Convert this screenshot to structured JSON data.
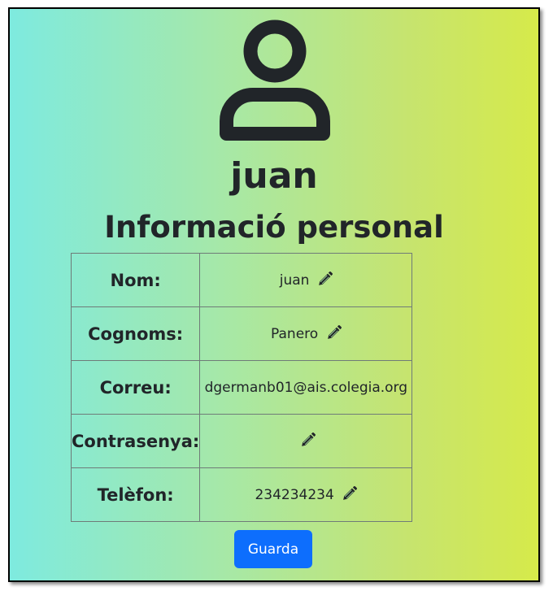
{
  "profile": {
    "username": "juan",
    "section_title": "Informació personal",
    "avatar_icon": "user-icon"
  },
  "fields": {
    "nom": {
      "label": "Nom:",
      "value": "juan",
      "editable": true
    },
    "cognoms": {
      "label": "Cognoms:",
      "value": "Panero",
      "editable": true
    },
    "correu": {
      "label": "Correu:",
      "value": "dgermanb01@ais.colegia.org",
      "editable": false
    },
    "contrasenya": {
      "label": "Contrasenya:",
      "value": "",
      "editable": true
    },
    "telefon": {
      "label": "Telèfon:",
      "value": "234234234",
      "editable": true
    }
  },
  "actions": {
    "save_label": "Guarda"
  },
  "colors": {
    "gradient_start": "#7eeadf",
    "gradient_end": "#d6ea4a",
    "button": "#0d6efd",
    "text": "#212529"
  },
  "icons": {
    "edit": "pencil-icon"
  }
}
